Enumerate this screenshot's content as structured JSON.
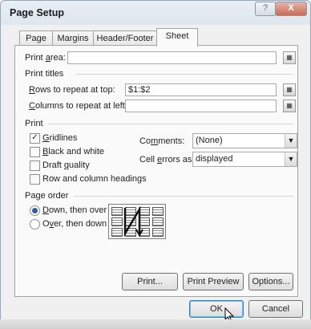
{
  "title": "Page Setup",
  "titlebar": {
    "help_label": "?",
    "close_label": "X"
  },
  "tabs": [
    {
      "label": "Page",
      "active": false
    },
    {
      "label": "Margins",
      "active": false
    },
    {
      "label": "Header/Footer",
      "active": false
    },
    {
      "label": "Sheet",
      "active": true
    }
  ],
  "print_area": {
    "label": "Print area:",
    "value": ""
  },
  "print_titles": {
    "heading": "Print titles",
    "rows_label": "Rows to repeat at top:",
    "rows_value": "$1:$2",
    "columns_label": "Columns to repeat at left:",
    "columns_value": ""
  },
  "print": {
    "heading": "Print",
    "gridlines": {
      "label": "Gridlines",
      "checked": true
    },
    "black_white": {
      "label": "Black and white",
      "checked": false
    },
    "draft_quality": {
      "label": "Draft quality",
      "checked": false
    },
    "row_col_headings": {
      "label": "Row and column headings",
      "checked": false
    },
    "comments_label": "Comments:",
    "comments_value": "(None)",
    "cell_errors_label": "Cell errors as:",
    "cell_errors_value": "displayed"
  },
  "page_order": {
    "heading": "Page order",
    "down_then_over": "Down, then over",
    "over_then_down": "Over, then down",
    "selected": "down_then_over"
  },
  "buttons": {
    "print": "Print...",
    "print_preview": "Print Preview",
    "options": "Options...",
    "ok": "OK",
    "cancel": "Cancel"
  },
  "check_glyph": "✓",
  "ref_glyph": "▦"
}
